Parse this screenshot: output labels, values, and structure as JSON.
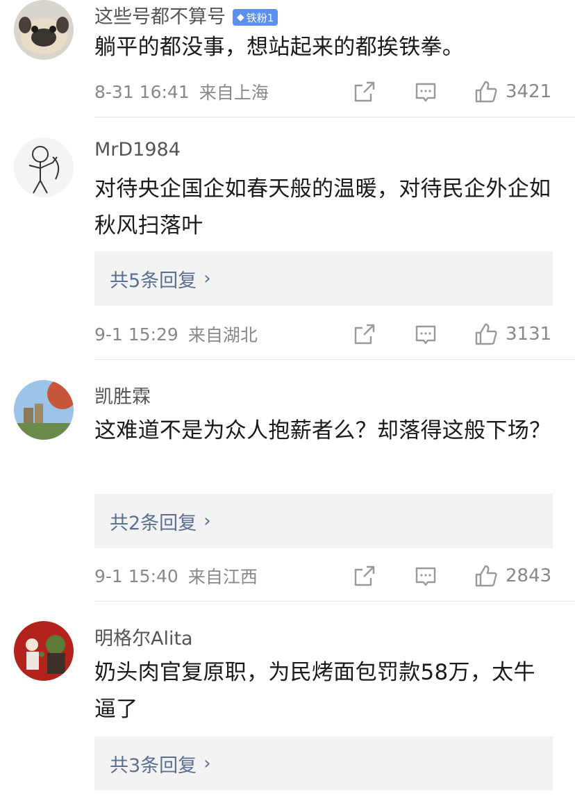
{
  "comments": [
    {
      "username": "这些号都不算号",
      "badge": "铁粉1",
      "text": "躺平的都没事，想站起来的都挨铁拳。",
      "time": "8-31 16:41",
      "location": "来自上海",
      "likes": "3421"
    },
    {
      "username": "MrD1984",
      "text": "对待央企国企如春天般的温暖，对待民企外企如秋风扫落叶",
      "replies": "共5条回复",
      "time": "9-1 15:29",
      "location": "来自湖北",
      "likes": "3131"
    },
    {
      "username": "凯胜霖",
      "text": "这难道不是为众人抱薪者么？却落得这般下场？",
      "replies": "共2条回复",
      "time": "9-1 15:40",
      "location": "来自江西",
      "likes": "2843"
    },
    {
      "username": "明格尔Alita",
      "text": "奶头肉官复原职，为民烤面包罚款58万，太牛逼了",
      "replies": "共3条回复"
    }
  ],
  "colors": {
    "link": "#5b6f94",
    "meta": "#888888",
    "badge": "#5b8ff0"
  }
}
